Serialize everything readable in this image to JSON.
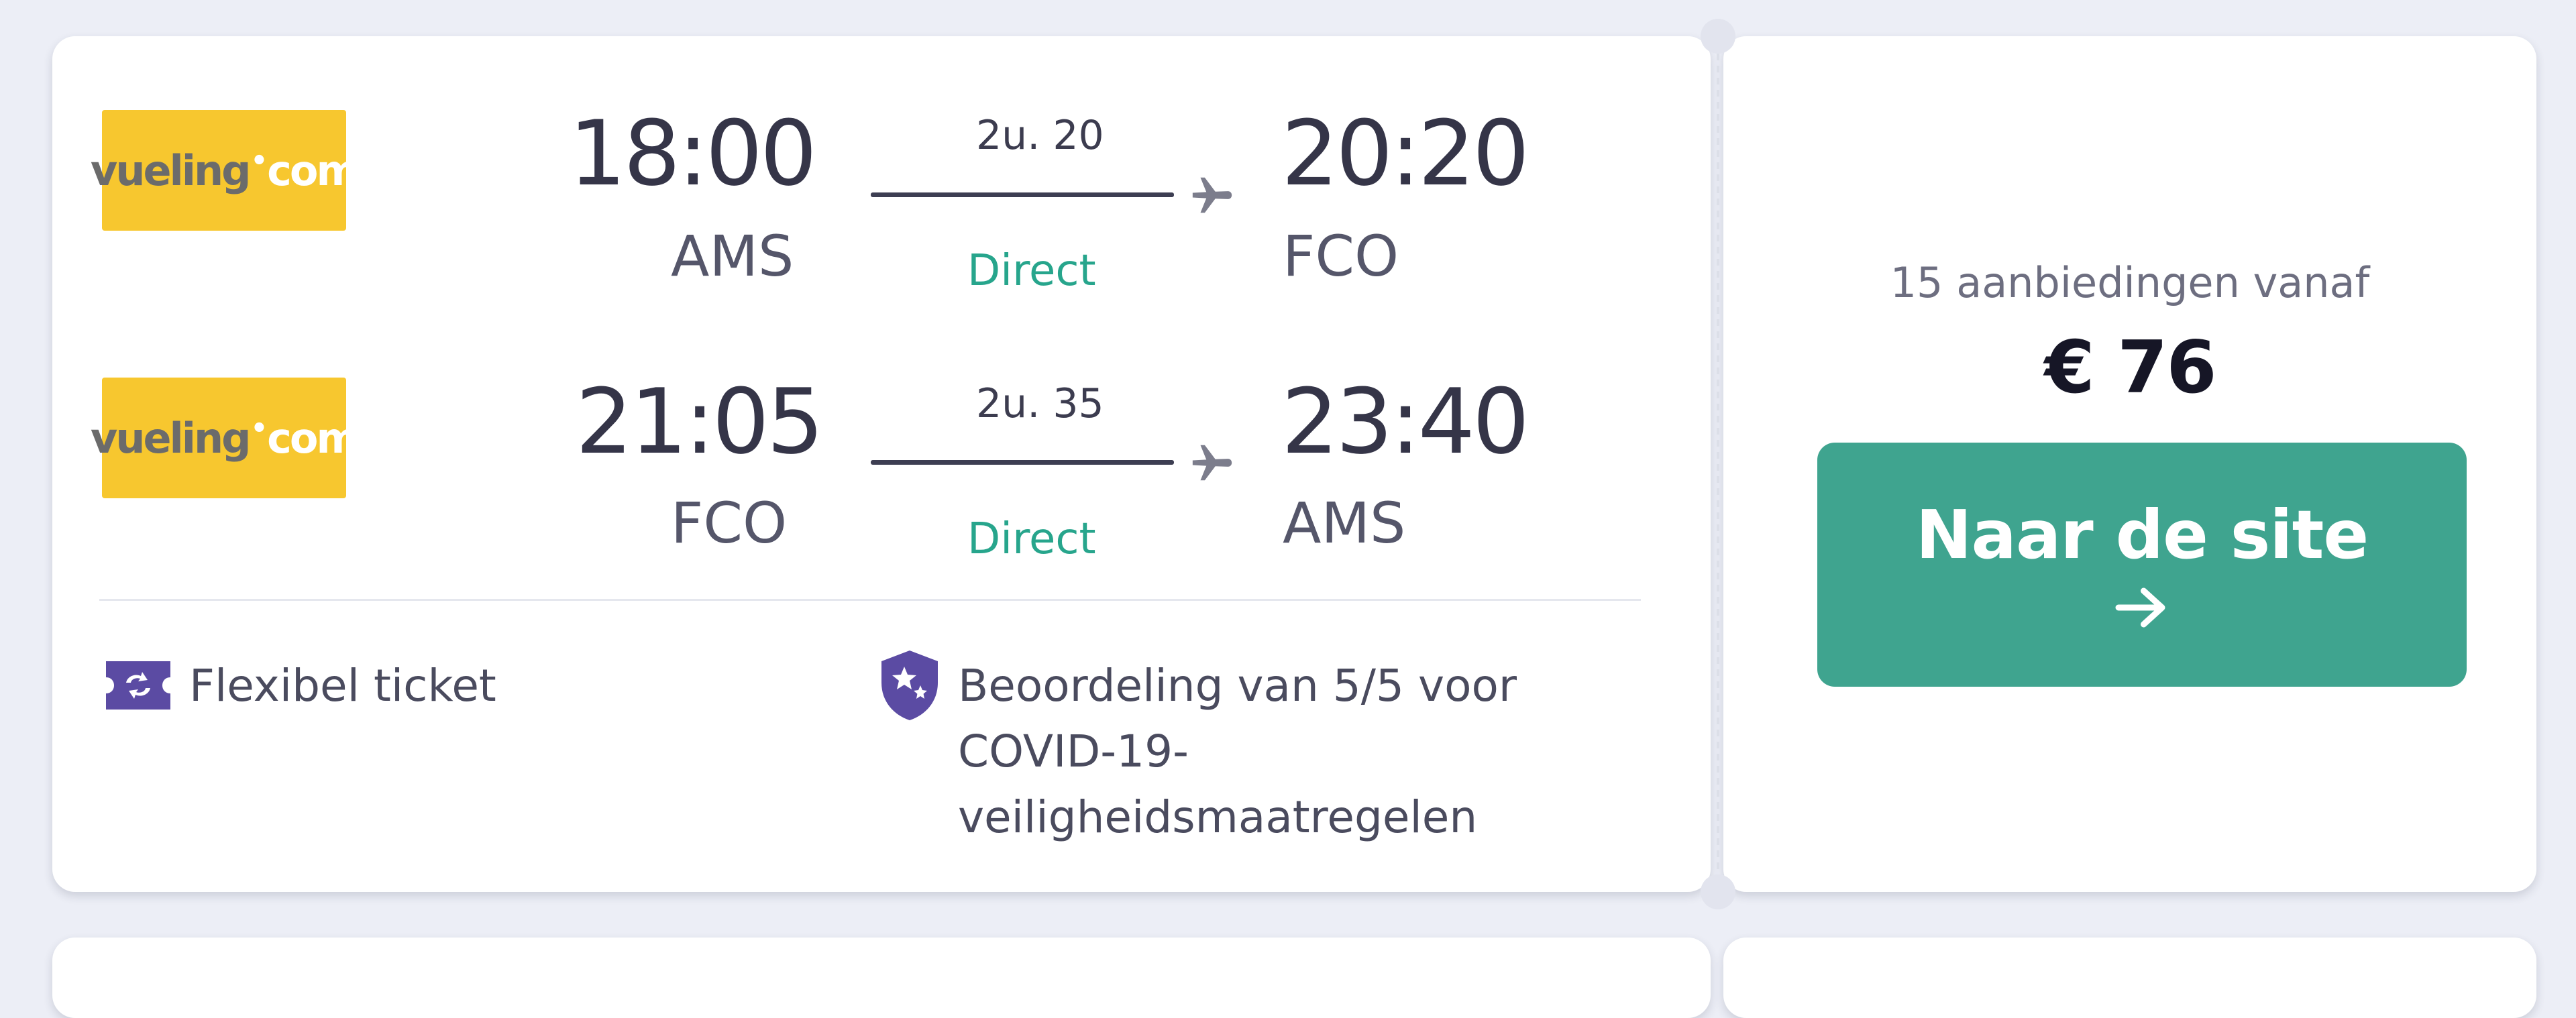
{
  "legs": [
    {
      "airline_logo": {
        "main": "vueling",
        "dot": "•",
        "suffix": "com"
      },
      "depart_time": "18:00",
      "depart_code": "AMS",
      "duration": "2u. 20",
      "stops": "Direct",
      "arrive_time": "20:20",
      "arrive_code": "FCO"
    },
    {
      "airline_logo": {
        "main": "vueling",
        "dot": "•",
        "suffix": "com"
      },
      "depart_time": "21:05",
      "depart_code": "FCO",
      "duration": "2u. 35",
      "stops": "Direct",
      "arrive_time": "23:40",
      "arrive_code": "AMS"
    }
  ],
  "features": {
    "flexible": {
      "icon": "flexible-ticket-icon",
      "label": "Flexibel ticket"
    },
    "covid": {
      "icon": "shield-star-icon",
      "line1": "Beoordeling van 5/5 voor",
      "line2": "COVID-19-",
      "line3": "veiligheidsmaatregelen"
    }
  },
  "offer": {
    "caption": "15 aanbiedingen vanaf",
    "price": "€ 76",
    "cta_label": "Naar de site",
    "cta_icon": "arrow-right-icon"
  },
  "colors": {
    "accent_green": "#3fa48f",
    "stops_green": "#27a58c",
    "logo_yellow": "#f7c72f",
    "feature_purple": "#5b4ba3"
  }
}
